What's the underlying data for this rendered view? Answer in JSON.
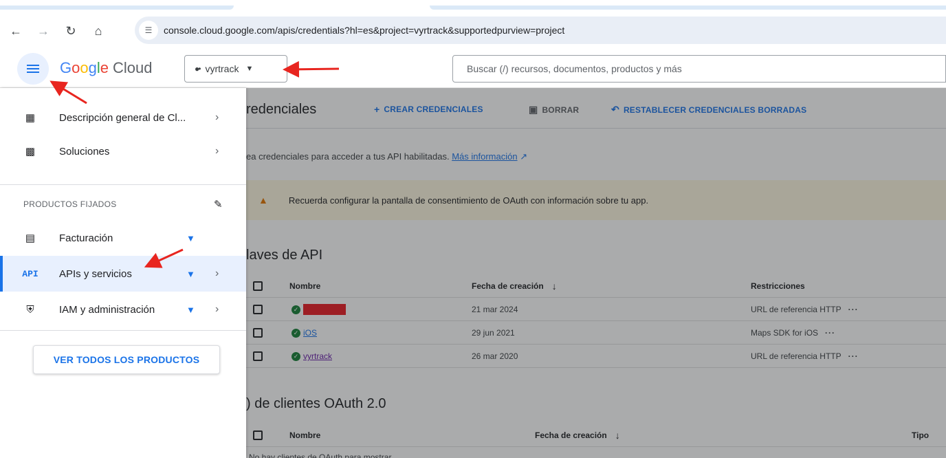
{
  "browser": {
    "url": "console.cloud.google.com/apis/credentials?hl=es&project=vyrtrack&supportedpurview=project"
  },
  "header": {
    "logo_google": "Google",
    "logo_cloud": "Cloud",
    "project_name": "vyrtrack",
    "search_placeholder": "Buscar (/) recursos, documentos, productos y más"
  },
  "drawer": {
    "items": [
      {
        "label": "Descripción general de Cl...",
        "icon": "dashboard-icon"
      },
      {
        "label": "Soluciones",
        "icon": "grid-icon"
      }
    ],
    "pinned_section_label": "PRODUCTOS FIJADOS",
    "pinned": [
      {
        "label": "Facturación",
        "icon": "billing-icon"
      },
      {
        "label": "APIs y servicios",
        "icon": "api-icon",
        "icon_text": "API"
      },
      {
        "label": "IAM y administración",
        "icon": "shield-icon"
      }
    ],
    "all_products_label": "VER TODOS LOS PRODUCTOS"
  },
  "main": {
    "title": "redenciales",
    "actions": {
      "create": "CREAR CREDENCIALES",
      "delete": "BORRAR",
      "restore": "RESTABLECER CREDENCIALES BORRADAS"
    },
    "intro_text": "ea credenciales para acceder a tus API habilitadas. ",
    "intro_link": "Más información",
    "warning": "Recuerda configurar la pantalla de consentimiento de OAuth con información sobre tu app.",
    "api_keys_title": "laves de API",
    "api_keys_columns": [
      "Nombre",
      "Fecha de creación",
      "Restricciones"
    ],
    "api_keys": [
      {
        "name": "",
        "date": "21 mar 2024",
        "restriction": "URL de referencia HTTP"
      },
      {
        "name": "iOS",
        "date": "29 jun 2021",
        "restriction": "Maps SDK for iOS"
      },
      {
        "name": "vyrtrack",
        "date": "26 mar 2020",
        "restriction": "URL de referencia HTTP"
      }
    ],
    "oauth_title": ") de clientes OAuth 2.0",
    "oauth_columns": [
      "Nombre",
      "Fecha de creación",
      "Tipo"
    ],
    "oauth_empty": "No hay clientes de OAuth para mostrar"
  },
  "colors": {
    "accent": "#1a73e8",
    "annotation_arrow": "#e8251f",
    "redaction": "#ea1c24"
  }
}
